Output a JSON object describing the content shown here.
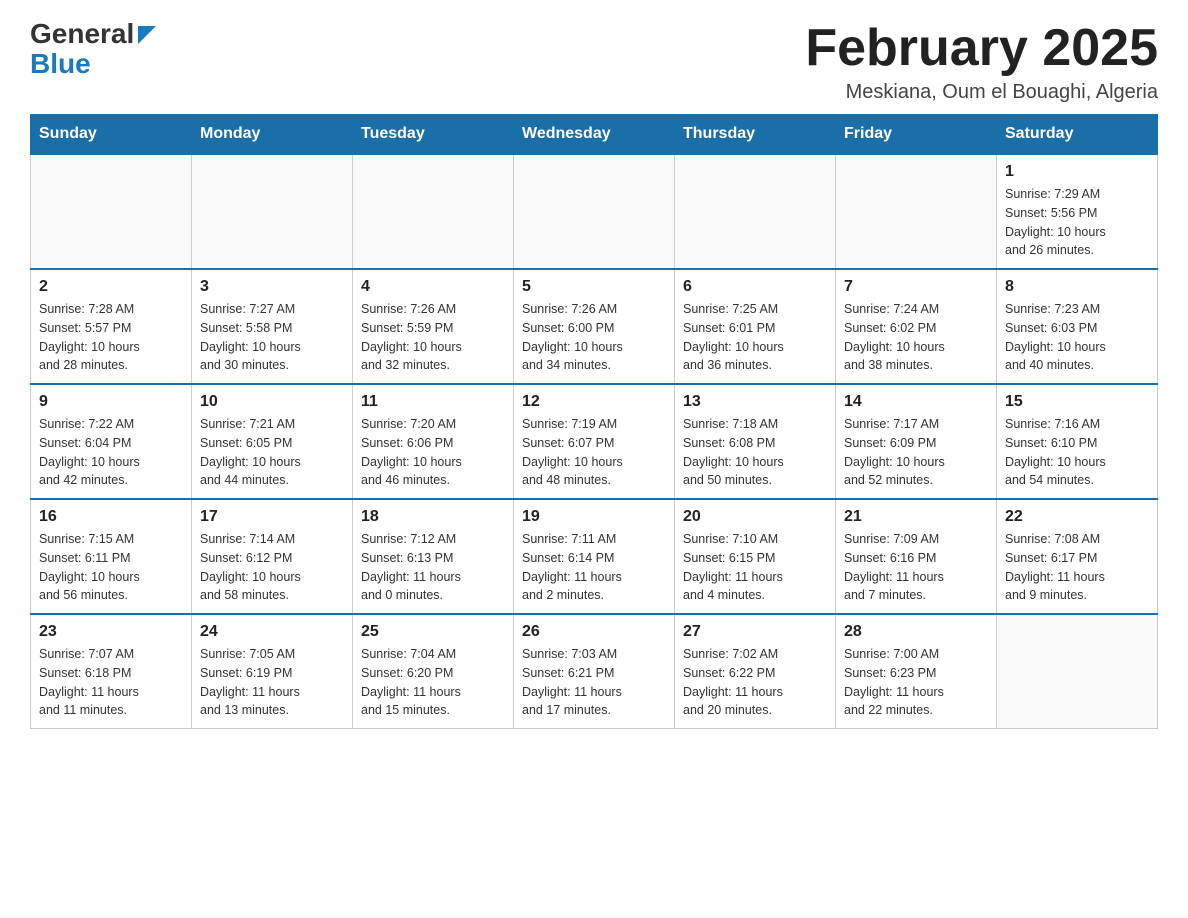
{
  "header": {
    "logo_general": "General",
    "logo_blue": "Blue",
    "month_title": "February 2025",
    "location": "Meskiana, Oum el Bouaghi, Algeria"
  },
  "days_of_week": [
    "Sunday",
    "Monday",
    "Tuesday",
    "Wednesday",
    "Thursday",
    "Friday",
    "Saturday"
  ],
  "weeks": [
    {
      "days": [
        {
          "num": "",
          "info": ""
        },
        {
          "num": "",
          "info": ""
        },
        {
          "num": "",
          "info": ""
        },
        {
          "num": "",
          "info": ""
        },
        {
          "num": "",
          "info": ""
        },
        {
          "num": "",
          "info": ""
        },
        {
          "num": "1",
          "info": "Sunrise: 7:29 AM\nSunset: 5:56 PM\nDaylight: 10 hours\nand 26 minutes."
        }
      ]
    },
    {
      "days": [
        {
          "num": "2",
          "info": "Sunrise: 7:28 AM\nSunset: 5:57 PM\nDaylight: 10 hours\nand 28 minutes."
        },
        {
          "num": "3",
          "info": "Sunrise: 7:27 AM\nSunset: 5:58 PM\nDaylight: 10 hours\nand 30 minutes."
        },
        {
          "num": "4",
          "info": "Sunrise: 7:26 AM\nSunset: 5:59 PM\nDaylight: 10 hours\nand 32 minutes."
        },
        {
          "num": "5",
          "info": "Sunrise: 7:26 AM\nSunset: 6:00 PM\nDaylight: 10 hours\nand 34 minutes."
        },
        {
          "num": "6",
          "info": "Sunrise: 7:25 AM\nSunset: 6:01 PM\nDaylight: 10 hours\nand 36 minutes."
        },
        {
          "num": "7",
          "info": "Sunrise: 7:24 AM\nSunset: 6:02 PM\nDaylight: 10 hours\nand 38 minutes."
        },
        {
          "num": "8",
          "info": "Sunrise: 7:23 AM\nSunset: 6:03 PM\nDaylight: 10 hours\nand 40 minutes."
        }
      ]
    },
    {
      "days": [
        {
          "num": "9",
          "info": "Sunrise: 7:22 AM\nSunset: 6:04 PM\nDaylight: 10 hours\nand 42 minutes."
        },
        {
          "num": "10",
          "info": "Sunrise: 7:21 AM\nSunset: 6:05 PM\nDaylight: 10 hours\nand 44 minutes."
        },
        {
          "num": "11",
          "info": "Sunrise: 7:20 AM\nSunset: 6:06 PM\nDaylight: 10 hours\nand 46 minutes."
        },
        {
          "num": "12",
          "info": "Sunrise: 7:19 AM\nSunset: 6:07 PM\nDaylight: 10 hours\nand 48 minutes."
        },
        {
          "num": "13",
          "info": "Sunrise: 7:18 AM\nSunset: 6:08 PM\nDaylight: 10 hours\nand 50 minutes."
        },
        {
          "num": "14",
          "info": "Sunrise: 7:17 AM\nSunset: 6:09 PM\nDaylight: 10 hours\nand 52 minutes."
        },
        {
          "num": "15",
          "info": "Sunrise: 7:16 AM\nSunset: 6:10 PM\nDaylight: 10 hours\nand 54 minutes."
        }
      ]
    },
    {
      "days": [
        {
          "num": "16",
          "info": "Sunrise: 7:15 AM\nSunset: 6:11 PM\nDaylight: 10 hours\nand 56 minutes."
        },
        {
          "num": "17",
          "info": "Sunrise: 7:14 AM\nSunset: 6:12 PM\nDaylight: 10 hours\nand 58 minutes."
        },
        {
          "num": "18",
          "info": "Sunrise: 7:12 AM\nSunset: 6:13 PM\nDaylight: 11 hours\nand 0 minutes."
        },
        {
          "num": "19",
          "info": "Sunrise: 7:11 AM\nSunset: 6:14 PM\nDaylight: 11 hours\nand 2 minutes."
        },
        {
          "num": "20",
          "info": "Sunrise: 7:10 AM\nSunset: 6:15 PM\nDaylight: 11 hours\nand 4 minutes."
        },
        {
          "num": "21",
          "info": "Sunrise: 7:09 AM\nSunset: 6:16 PM\nDaylight: 11 hours\nand 7 minutes."
        },
        {
          "num": "22",
          "info": "Sunrise: 7:08 AM\nSunset: 6:17 PM\nDaylight: 11 hours\nand 9 minutes."
        }
      ]
    },
    {
      "days": [
        {
          "num": "23",
          "info": "Sunrise: 7:07 AM\nSunset: 6:18 PM\nDaylight: 11 hours\nand 11 minutes."
        },
        {
          "num": "24",
          "info": "Sunrise: 7:05 AM\nSunset: 6:19 PM\nDaylight: 11 hours\nand 13 minutes."
        },
        {
          "num": "25",
          "info": "Sunrise: 7:04 AM\nSunset: 6:20 PM\nDaylight: 11 hours\nand 15 minutes."
        },
        {
          "num": "26",
          "info": "Sunrise: 7:03 AM\nSunset: 6:21 PM\nDaylight: 11 hours\nand 17 minutes."
        },
        {
          "num": "27",
          "info": "Sunrise: 7:02 AM\nSunset: 6:22 PM\nDaylight: 11 hours\nand 20 minutes."
        },
        {
          "num": "28",
          "info": "Sunrise: 7:00 AM\nSunset: 6:23 PM\nDaylight: 11 hours\nand 22 minutes."
        },
        {
          "num": "",
          "info": ""
        }
      ]
    }
  ]
}
